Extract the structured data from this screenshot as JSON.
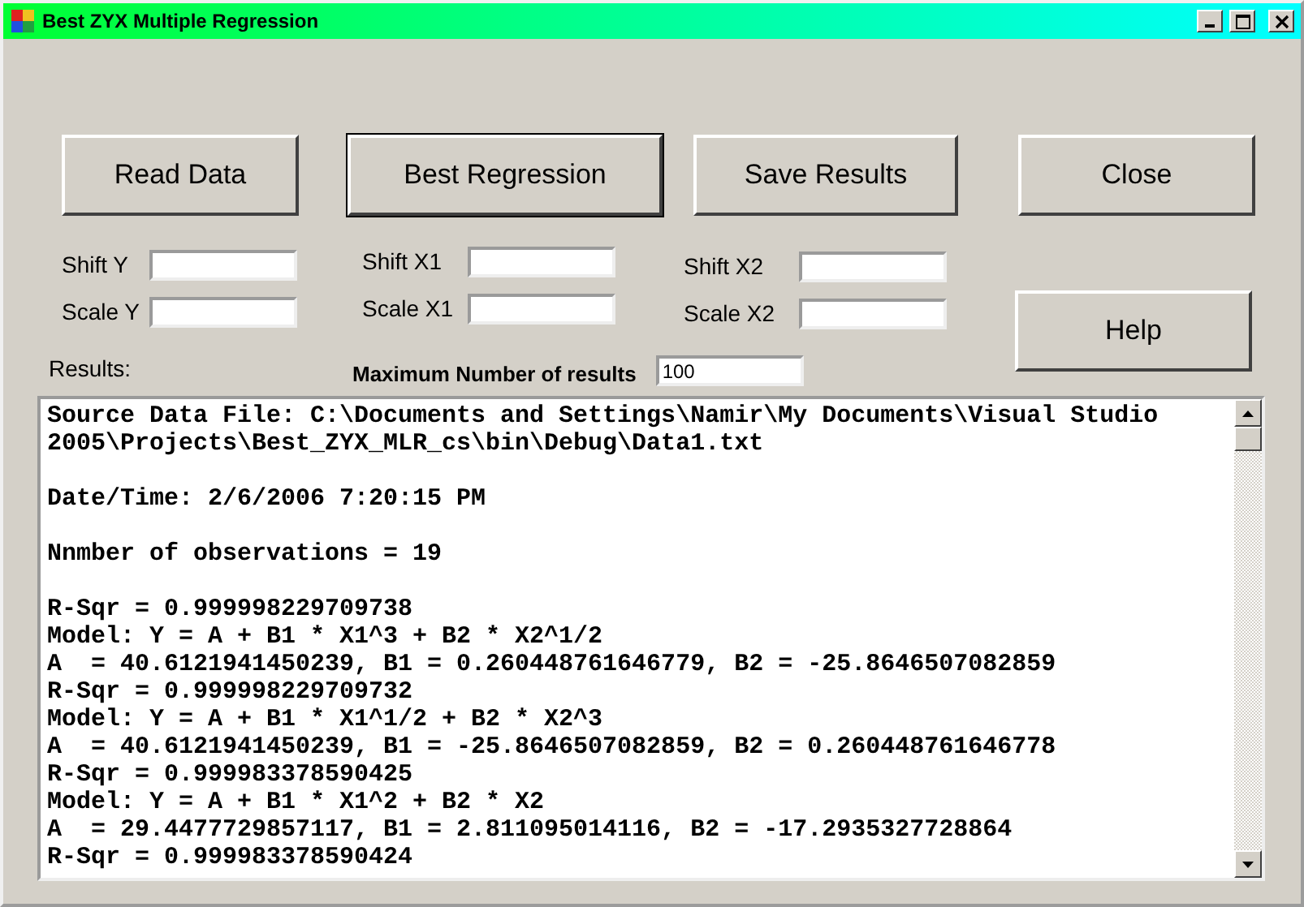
{
  "window": {
    "title": "Best ZYX Multiple Regression"
  },
  "buttons": [
    {
      "label": "Read Data",
      "focused": false
    },
    {
      "label": "Best Regression",
      "focused": true
    },
    {
      "label": "Save Results",
      "focused": false
    },
    {
      "label": "Close",
      "focused": false
    }
  ],
  "fields": [
    {
      "label": "Shift Y"
    },
    {
      "label": "Scale Y"
    },
    {
      "label": "Shift X1"
    },
    {
      "label": "Scale X1"
    },
    {
      "label": "Shift X2"
    },
    {
      "label": "Scale X2"
    }
  ],
  "help_button": {
    "label": "Help"
  },
  "results_label": "Results:",
  "max_results": {
    "label": "Maximum Number of results",
    "value": "100"
  },
  "results": {
    "blocks": [
      {
        "lines": [
          "Source Data File: C:\\Documents and Settings\\Namir\\My Documents\\Visual Studio",
          "2005\\Projects\\Best_ZYX_MLR_cs\\bin\\Debug\\Data1.txt"
        ]
      },
      {
        "lines": [
          "Date/Time: 2/6/2006 7:20:15 PM"
        ]
      },
      {
        "lines": [
          "Nnmber of observations = 19"
        ]
      },
      {
        "lines": [
          "R-Sqr = 0.999998229709738",
          "Model: Y = A + B1 * X1^3 + B2 * X2^1/2",
          "A  = 40.6121941450239, B1 = 0.260448761646779, B2 = -25.8646507082859",
          "R-Sqr = 0.999998229709732",
          "Model: Y = A + B1 * X1^1/2 + B2 * X2^3",
          "A  = 40.6121941450239, B1 = -25.8646507082859, B2 = 0.260448761646778",
          "R-Sqr = 0.999983378590425",
          "Model: Y = A + B1 * X1^2 + B2 * X2",
          "A  = 29.4477729857117, B1 = 2.811095014116, B2 = -17.2935327728864",
          "R-Sqr = 0.999983378590424"
        ]
      }
    ]
  }
}
